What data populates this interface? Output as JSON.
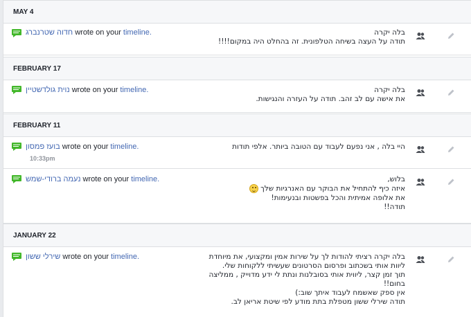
{
  "sections": [
    {
      "date": "MAY 4",
      "posts": [
        {
          "author": "חדוה שטרנברג",
          "action": " wrote on your ",
          "target": "timeline.",
          "time": "",
          "lines": [
            "בלה יקרה",
            "תודה על העצה בשיחה הטלפונית. זה בהחלט היה במקום!!!!"
          ]
        }
      ]
    },
    {
      "date": "FEBRUARY 17",
      "posts": [
        {
          "author": "נוית גולדשטיין",
          "action": " wrote on your ",
          "target": "timeline.",
          "time": "",
          "lines": [
            "בלה יקרה",
            "את אישה עם לב זהב. תודה על העזרה והנגישות."
          ]
        }
      ]
    },
    {
      "date": "FEBRUARY 11",
      "posts": [
        {
          "author": "בועז פמסון",
          "action": " wrote on your ",
          "target": "timeline.",
          "time": "10:33pm",
          "lines": [
            "היי בלה , אני נפעם לעבוד עם הטובה ביותר. אלפי תודות"
          ]
        },
        {
          "author": "נעמה ברודי-שמש",
          "action": " wrote on your ",
          "target": "timeline.",
          "time": "",
          "lines": [
            "בלוש,",
            "איזה כיף להתחיל את הבוקר עם האנרגיות שלך",
            "את אלופה אמיתית והכל בפשטות ובנעימות!",
            "תודה!!"
          ]
        }
      ]
    },
    {
      "date": "JANUARY 22",
      "posts": [
        {
          "author": "שירלי ששון",
          "action": " wrote on your ",
          "target": "timeline.",
          "time": "",
          "lines": [
            "בלה יקרה רציתי להודות לך על שירות אמין ומקצועי, את מיוחדת",
            "ליוות אותי בשכתוב ופרסום הסרטונים שעשיתי ללקוחות שלי.",
            "תוך זמן קצר, ליווית אותי בסובלנות ונתת לי ידע מדוייק , ממליצה",
            "בחום!!",
            "אין ספק שאשמח לעבוד איתך שוב:)",
            "תודה שירלי ששון מטפלת בתת מודע לפי שיטת אריאן לב."
          ]
        }
      ]
    }
  ],
  "icons": {
    "message": "message-bubble-icon",
    "audience": "friends-icon",
    "edit": "pencil-icon"
  },
  "colors": {
    "link": "#4267b2",
    "message_icon": "#42b72a",
    "header_bg": "#f6f7f9"
  }
}
